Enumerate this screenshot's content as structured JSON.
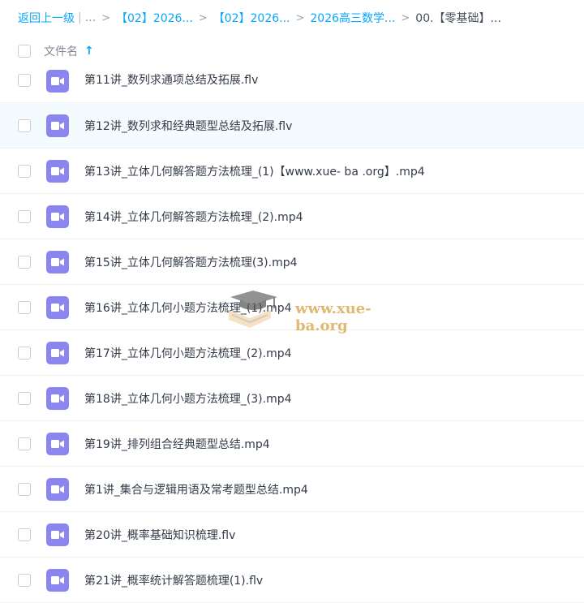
{
  "breadcrumb": {
    "back_label": "返回上一级",
    "separator": "|",
    "ellipsis": "...",
    "chevron": ">",
    "items": [
      "【02】2026...",
      "【02】2026...",
      "2026高三数学...",
      "00.【零基础】..."
    ]
  },
  "header": {
    "column_label": "文件名",
    "sort_indicator": "↑"
  },
  "files": [
    {
      "name": "第11讲_数列求通项总结及拓展.flv",
      "icon": "video-file-icon"
    },
    {
      "name": "第12讲_数列求和经典题型总结及拓展.flv",
      "icon": "video-file-icon"
    },
    {
      "name": "第13讲_立体几何解答题方法梳理_(1)【www.xue- ba .org】.mp4",
      "icon": "video-file-icon"
    },
    {
      "name": "第14讲_立体几何解答题方法梳理_(2).mp4",
      "icon": "video-file-icon"
    },
    {
      "name": "第15讲_立体几何解答题方法梳理(3).mp4",
      "icon": "video-file-icon"
    },
    {
      "name": "第16讲_立体几何小题方法梳理_(1).mp4",
      "icon": "video-file-icon"
    },
    {
      "name": "第17讲_立体几何小题方法梳理_(2).mp4",
      "icon": "video-file-icon"
    },
    {
      "name": "第18讲_立体几何小题方法梳理_(3).mp4",
      "icon": "video-file-icon"
    },
    {
      "name": "第19讲_排列组合经典题型总结.mp4",
      "icon": "video-file-icon"
    },
    {
      "name": "第1讲_集合与逻辑用语及常考题型总结.mp4",
      "icon": "video-file-icon"
    },
    {
      "name": "第20讲_概率基础知识梳理.flv",
      "icon": "video-file-icon"
    },
    {
      "name": "第21讲_概率统计解答题梳理(1).flv",
      "icon": "video-file-icon"
    }
  ],
  "watermark": {
    "text": "www.xue-ba.org",
    "icon": "graduation-cap-logo"
  },
  "colors": {
    "accent": "#06a7ff",
    "video_icon": "#8b86ef",
    "row_highlight": "#f4fbff"
  }
}
